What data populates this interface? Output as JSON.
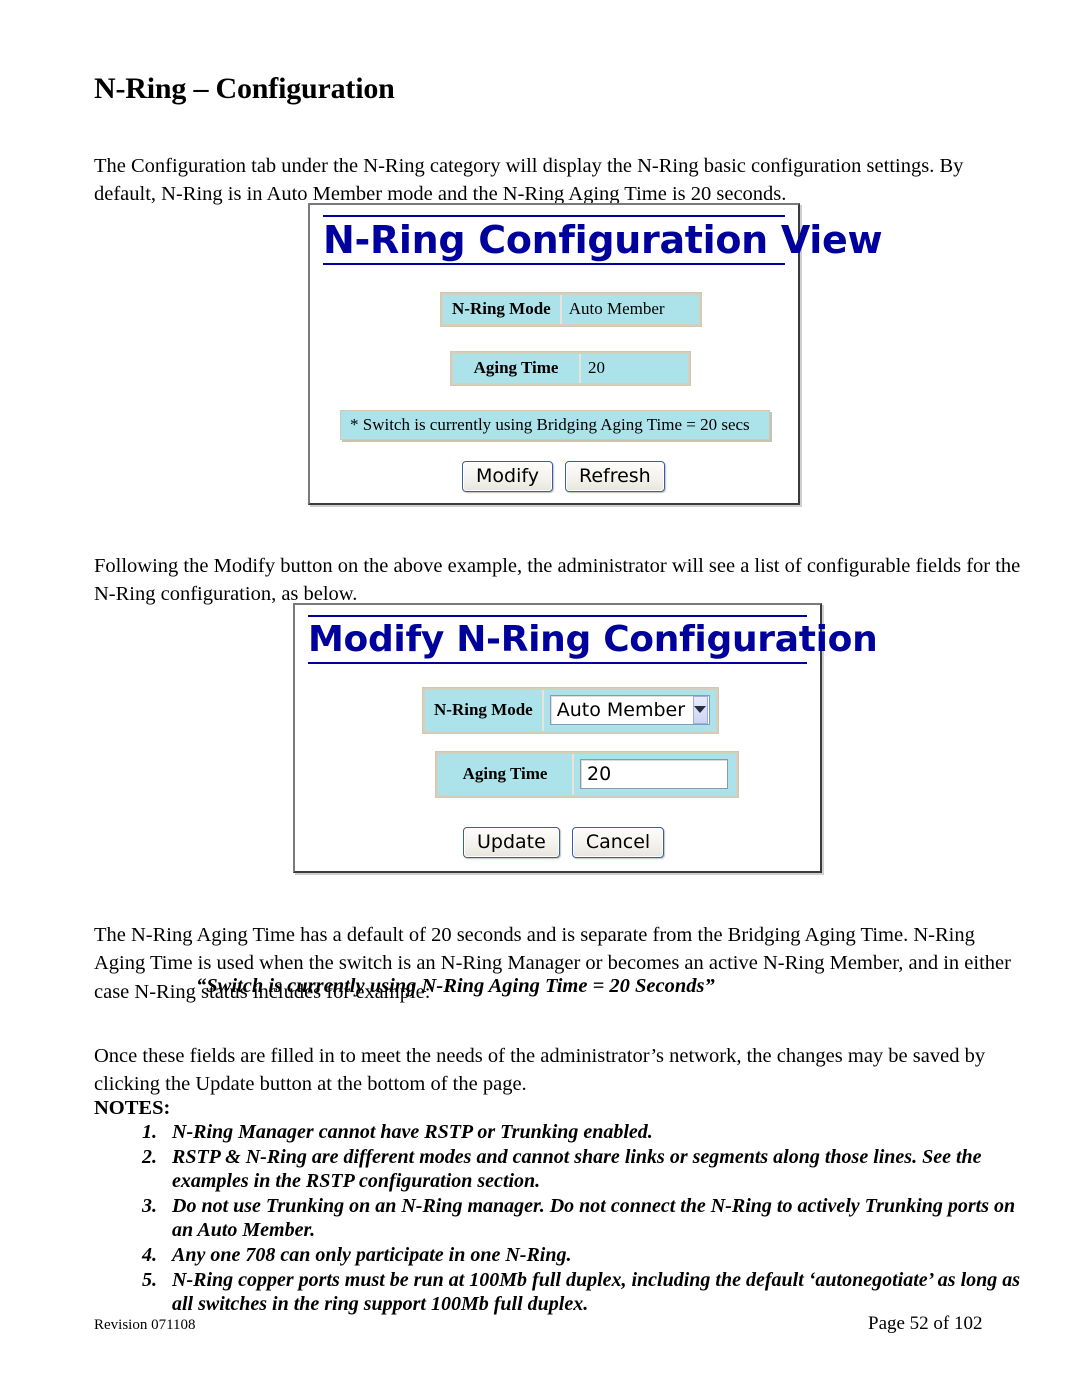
{
  "document": {
    "title": "N-Ring – Configuration",
    "paragraphs": [
      "The Configuration tab under the N-Ring category will display the N-Ring basic configuration settings.  By default, N-Ring is in Auto Member mode and the N-Ring Aging Time is 20 seconds.",
      "Following the Modify button on the above example, the administrator will see a list of configurable fields for the N-Ring configuration, as below.",
      "The N-Ring Aging Time has a default of 20 seconds and is separate from the Bridging Aging Time.  N-Ring Aging Time is used when the switch is an N-Ring Manager or becomes an active N-Ring Member, and in either case N-Ring status includes for example:",
      "Once these fields are filled in to meet the needs of the administrator’s network, the changes may be saved by clicking the Update button at the bottom of the page."
    ],
    "quote": "“Switch is currently using N-Ring Aging Time = 20 Seconds”",
    "notes_heading": "NOTES:",
    "notes": [
      {
        "num": "1.",
        "text": "N-Ring Manager cannot have RSTP or Trunking enabled."
      },
      {
        "num": "2.",
        "text": "RSTP & N-Ring are different modes and cannot share links or segments along those lines. See the examples in the RSTP configuration section."
      },
      {
        "num": "3.",
        "text": "Do not use Trunking on an N-Ring manager. Do not connect the N-Ring to actively Trunking ports on an Auto Member."
      },
      {
        "num": "4.",
        "text": "Any one 708 can only participate in one N-Ring."
      },
      {
        "num": "5.",
        "text": "N-Ring copper ports must be run at 100Mb full duplex, including the default ‘autonegotiate’ as long as all switches in the ring support 100Mb full duplex."
      }
    ],
    "footer": {
      "revision": "Revision 071108",
      "page": "Page 52 of 102"
    }
  },
  "screenshot_view": {
    "panel_title": "N-Ring Configuration View",
    "fields": [
      {
        "label": "N-Ring Mode",
        "value": "Auto Member"
      },
      {
        "label": "Aging Time",
        "value": "20"
      }
    ],
    "status_note": "* Switch is currently using Bridging Aging Time = 20 secs",
    "buttons": [
      {
        "label": "Modify"
      },
      {
        "label": "Refresh"
      }
    ]
  },
  "screenshot_modify": {
    "panel_title": "Modify N-Ring Configuration",
    "mode_field": {
      "label": "N-Ring Mode",
      "selected": "Auto Member"
    },
    "aging_field": {
      "label": "Aging Time",
      "value": "20"
    },
    "buttons": [
      {
        "label": "Update"
      },
      {
        "label": "Cancel"
      }
    ]
  },
  "colors": {
    "panel_title": "#00009c",
    "cell_background": "#ace3ea",
    "cell_border": "#d6cfbd"
  }
}
